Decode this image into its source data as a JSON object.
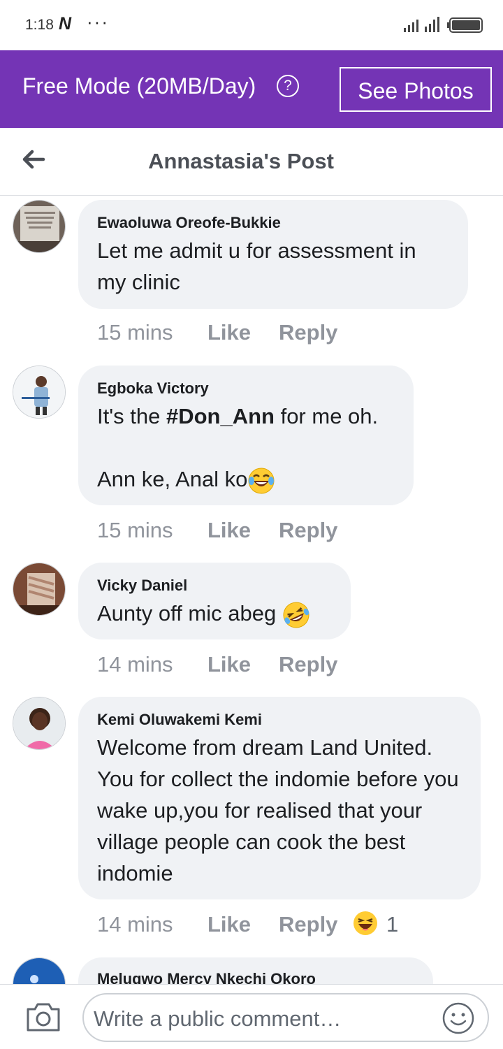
{
  "status_bar": {
    "time": "1:18",
    "notification_icon": "N",
    "more": "···"
  },
  "banner": {
    "text": "Free Mode (20MB/Day)",
    "help_icon": "?",
    "button_label": "See Photos",
    "color": "#7434b5"
  },
  "header": {
    "title": "Annastasia's Post"
  },
  "comments": [
    {
      "author": "Ewaoluwa Oreofe-Bukkie",
      "text": "Let me admit u for assessment in my clinic",
      "time": "15 mins",
      "like": "Like",
      "reply": "Reply"
    },
    {
      "author": "Egboka Victory",
      "text_before": "It's the ",
      "text_bold": "#Don_Ann",
      "text_after": " for me oh.\n\nAnn ke, Anal ko",
      "time": "15 mins",
      "like": "Like",
      "reply": "Reply"
    },
    {
      "author": "Vicky Daniel",
      "text": "Aunty off mic abeg ",
      "time": "14 mins",
      "like": "Like",
      "reply": "Reply"
    },
    {
      "author": "Kemi Oluwakemi Kemi",
      "text": "Welcome from dream Land United. You for collect the indomie before you wake up,you for realised that your village people can cook the best indomie",
      "time": "14 mins",
      "like": "Like",
      "reply": "Reply",
      "reaction_count": "1"
    },
    {
      "author": "Melugwo Mercy Nkechi Okoro"
    }
  ],
  "composer": {
    "placeholder": "Write a public comment…"
  }
}
